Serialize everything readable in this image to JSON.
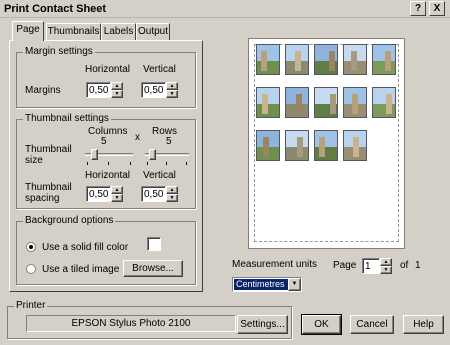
{
  "window": {
    "title": "Print Contact Sheet",
    "help_glyph": "?",
    "close_glyph": "X"
  },
  "tabs": [
    {
      "label": "Page",
      "active": true
    },
    {
      "label": "Thumbnails",
      "active": false
    },
    {
      "label": "Labels",
      "active": false
    },
    {
      "label": "Output",
      "active": false
    }
  ],
  "margin_settings": {
    "title": "Margin settings",
    "col_horizontal": "Horizontal",
    "col_vertical": "Vertical",
    "row_label": "Margins",
    "horizontal_value": "0,50",
    "vertical_value": "0,50"
  },
  "thumbnail_settings": {
    "title": "Thumbnail settings",
    "columns_label": "Columns",
    "columns_value": "5",
    "times": "x",
    "rows_label": "Rows",
    "rows_value": "5",
    "size_label_1": "Thumbnail",
    "size_label_2": "size",
    "col_horizontal": "Horizontal",
    "col_vertical": "Vertical",
    "spacing_label_1": "Thumbnail",
    "spacing_label_2": "spacing",
    "spacing_horizontal": "0,50",
    "spacing_vertical": "0,50"
  },
  "background_options": {
    "title": "Background options",
    "solid_fill_label": "Use a solid fill color",
    "solid_fill_selected": true,
    "tiled_image_label": "Use a tiled image",
    "browse_label": "Browse...",
    "fill_color": "#ffffff"
  },
  "preview": {
    "columns": 5,
    "rows_shown": 3,
    "thumbnail_count": 14
  },
  "measurement": {
    "label": "Measurement units",
    "selected": "Centimetres"
  },
  "paging": {
    "page_label": "Page",
    "page_value": "1",
    "of_label": "of",
    "total": "1"
  },
  "printer": {
    "title": "Printer",
    "name": "EPSON Stylus Photo 2100",
    "settings_label": "Settings..."
  },
  "buttons": {
    "ok": "OK",
    "cancel": "Cancel",
    "help": "Help"
  },
  "colors": {
    "face": "#d4d0c8",
    "highlight": "#0a246a"
  }
}
